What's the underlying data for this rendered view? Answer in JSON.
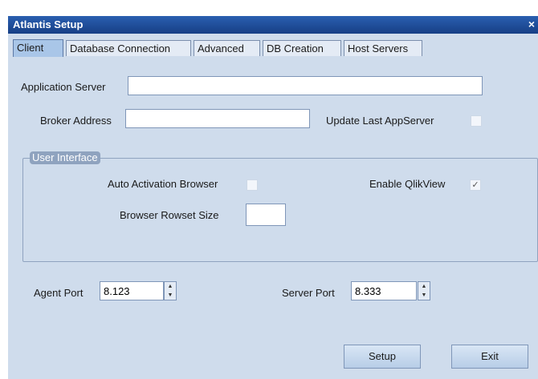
{
  "window": {
    "title": "Atlantis Setup",
    "close_glyph": "×"
  },
  "tabs": [
    {
      "label": "Client",
      "active": true
    },
    {
      "label": "Database Connection",
      "active": false
    },
    {
      "label": "Advanced",
      "active": false
    },
    {
      "label": "DB Creation",
      "active": false
    },
    {
      "label": "Host Servers",
      "active": false
    }
  ],
  "client": {
    "application_server_label": "Application Server",
    "application_server_value": "",
    "broker_address_label": "Broker Address",
    "broker_address_value": "",
    "update_last_appserver_label": "Update Last AppServer",
    "update_last_appserver_checked": false,
    "user_interface_group_label": "User Interface",
    "auto_activation_browser_label": "Auto Activation Browser",
    "auto_activation_browser_checked": false,
    "enable_qlikview_label": "Enable QlikView",
    "enable_qlikview_checked": true,
    "check_glyph": "✓",
    "browser_rowset_size_label": "Browser Rowset Size",
    "browser_rowset_size_value": "",
    "agent_port_label": "Agent Port",
    "agent_port_value": "8.123",
    "server_port_label": "Server Port",
    "server_port_value": "8.333",
    "spin_up_glyph": "▲",
    "spin_down_glyph": "▼"
  },
  "buttons": {
    "setup_label": "Setup",
    "exit_label": "Exit"
  }
}
